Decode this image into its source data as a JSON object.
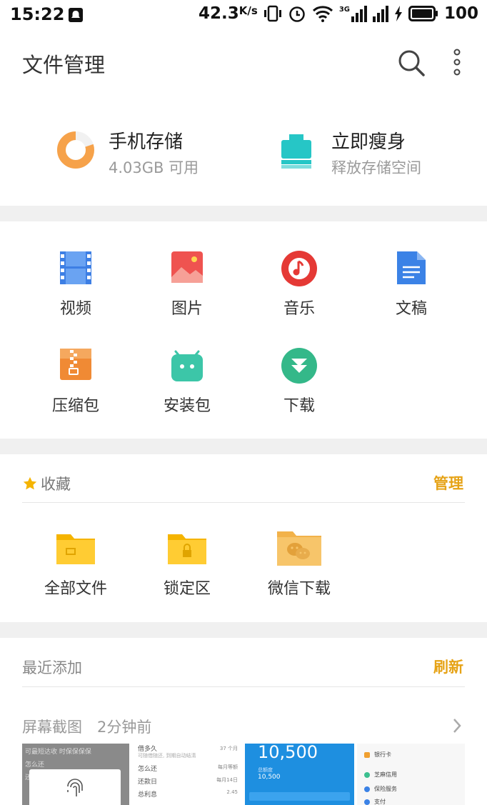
{
  "status_bar": {
    "time": "15:22",
    "speed": "42.3",
    "speed_unit": "K/s",
    "network": "3G",
    "battery": "100"
  },
  "app_bar": {
    "title": "文件管理",
    "search_icon": "search-icon",
    "more_icon": "more-vertical-icon"
  },
  "storage": [
    {
      "title": "手机存储",
      "subtitle": "4.03GB 可用",
      "icon": "storage-donut-icon",
      "used_fraction": 0.8,
      "color": "#f6a24a"
    },
    {
      "title": "立即瘦身",
      "subtitle": "释放存储空间",
      "icon": "clean-icon",
      "color": "#26c6c6"
    }
  ],
  "categories": [
    {
      "label": "视频",
      "icon": "video-icon",
      "color": "#3d7fe4"
    },
    {
      "label": "图片",
      "icon": "image-icon",
      "color": "#ef5350"
    },
    {
      "label": "音乐",
      "icon": "music-icon",
      "color": "#e53935"
    },
    {
      "label": "文稿",
      "icon": "document-icon",
      "color": "#3b82e6"
    },
    {
      "label": "压缩包",
      "icon": "archive-icon",
      "color": "#f08a34"
    },
    {
      "label": "安装包",
      "icon": "android-icon",
      "color": "#3cc6a8"
    },
    {
      "label": "下载",
      "icon": "download-icon",
      "color": "#34b889"
    }
  ],
  "favorites": {
    "title": "收藏",
    "action": "管理",
    "items": [
      {
        "label": "全部文件",
        "icon": "folder-icon",
        "color": "#f5b400"
      },
      {
        "label": "锁定区",
        "icon": "locked-folder-icon",
        "color": "#f5b400"
      },
      {
        "label": "微信下载",
        "icon": "wechat-folder-icon",
        "color": "#f7c56a"
      }
    ]
  },
  "recent": {
    "title": "最近添加",
    "action": "刷新",
    "group_name": "屏幕截图",
    "group_time": "2分钟前",
    "thumb1": {
      "items": [
        "可最短达收 时保保保保",
        "怎么还",
        "还"
      ]
    },
    "thumb2": {
      "rows": [
        "借多久",
        "可随借随还, 到期自动结清",
        "怎么还",
        "还款日",
        "总利息"
      ],
      "values": [
        "37 个月",
        "每月等额",
        "每月14日",
        "2.45"
      ]
    },
    "thumb3": {
      "amount": "10,500",
      "label": "总额度",
      "sub": "10,500"
    },
    "thumb4": {
      "items": [
        "银行卡",
        "芝麻信用",
        "保险服务",
        "支付"
      ]
    }
  },
  "colors": {
    "accent": "#e6a317",
    "band": "#f0f0f0"
  }
}
